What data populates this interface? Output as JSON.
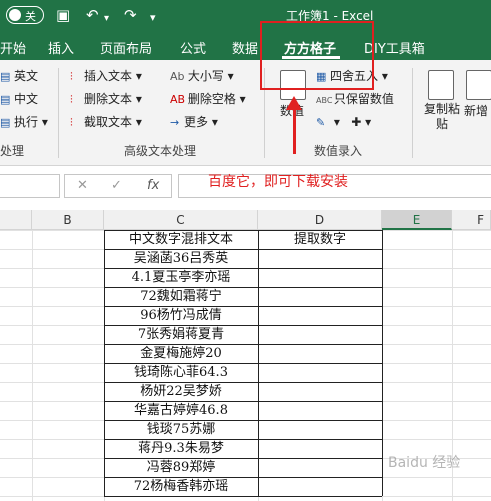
{
  "titlebar": {
    "autosave_label": "关",
    "title": "工作簿1  -  Excel"
  },
  "tabs": [
    {
      "label": "开始"
    },
    {
      "label": "插入"
    },
    {
      "label": "页面布局"
    },
    {
      "label": "公式"
    },
    {
      "label": "数据"
    },
    {
      "label": "方方格子",
      "active": true
    },
    {
      "label": "DIY工具箱"
    }
  ],
  "ribbon": {
    "left_items": [
      "英文",
      "中文",
      "执行"
    ],
    "left_group_label": "处理",
    "text_items": [
      "插入文本",
      "删除文本",
      "截取文本"
    ],
    "text_items2": [
      "大小写",
      "删除空格",
      "更多"
    ],
    "text_group_label": "高级文本处理",
    "value_big_label": "数值",
    "value_items": [
      "四舍五入",
      "只保留数值"
    ],
    "value_group_label": "数值录入",
    "copy_paste_label": "复制粘贴",
    "new_label": "新增"
  },
  "formula_bar": {
    "fx": "fx",
    "annotation": "百度它，即可下载安装"
  },
  "grid": {
    "columns": [
      "B",
      "C",
      "D",
      "E",
      "F"
    ],
    "selected_column": "E",
    "header_c": "中文数字混排文本",
    "header_d": "提取数字",
    "rows": [
      "吴涵菡36吕秀英",
      "4.1夏玉亭李亦瑶",
      "72魏如霜蒋宁",
      "96杨竹冯成倩",
      "7张秀娟蒋夏青",
      "金夏梅施婷20",
      "钱琦陈心菲64.3",
      "杨妍22吴梦娇",
      "华嘉古婷婷46.8",
      "钱琰75苏娜",
      "蒋丹9.3朱易梦",
      "冯蓉89郑婷",
      "72杨梅香韩亦瑶"
    ]
  },
  "watermark": "Baidu 经验",
  "colors": {
    "excel_green": "#217346",
    "highlight_red": "#e02020"
  }
}
